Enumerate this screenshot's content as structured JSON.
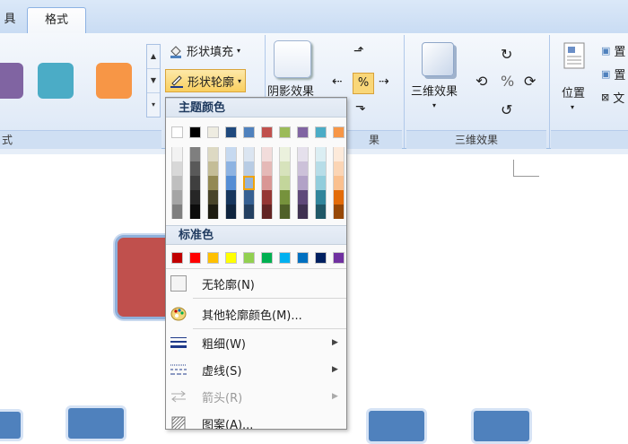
{
  "tabs": {
    "left_fragment": "具",
    "format": "格式"
  },
  "ribbon": {
    "shape_styles": {
      "group_label": "式",
      "swatch_colors": [
        "#8064a2",
        "#4bacc6",
        "#f79646"
      ],
      "fill_label": "形状填充",
      "outline_label": "形状轮廓"
    },
    "shadow_effects": {
      "button_label": "阴影效果",
      "group_label_fragment": "果"
    },
    "three_d": {
      "button_label": "三维效果",
      "group_label": "三维效果"
    },
    "arrange": {
      "position_label": "位置",
      "right_fragments": [
        "置",
        "置",
        "文"
      ]
    }
  },
  "menu": {
    "theme_colors_header": "主题颜色",
    "theme_base_colors": [
      "#ffffff",
      "#000000",
      "#eeece1",
      "#1f497d",
      "#4f81bd",
      "#c0504d",
      "#9bbb59",
      "#8064a2",
      "#4bacc6",
      "#f79646"
    ],
    "theme_shades": [
      [
        "#f2f2f2",
        "#d8d8d8",
        "#bfbfbf",
        "#a5a5a5",
        "#7f7f7f"
      ],
      [
        "#7f7f7f",
        "#595959",
        "#3f3f3f",
        "#262626",
        "#0c0c0c"
      ],
      [
        "#ddd9c3",
        "#c4bd97",
        "#938953",
        "#494429",
        "#1d1b10"
      ],
      [
        "#c6d9f0",
        "#8db3e2",
        "#548dd4",
        "#17365d",
        "#0f243e"
      ],
      [
        "#dbe5f1",
        "#b8cce4",
        "#95b3d7",
        "#366092",
        "#244061"
      ],
      [
        "#f2dcdb",
        "#e5b9b7",
        "#d99694",
        "#953734",
        "#632423"
      ],
      [
        "#ebf1dd",
        "#d7e3bc",
        "#c3d69b",
        "#76923c",
        "#4f6128"
      ],
      [
        "#e5e0ec",
        "#ccc1d9",
        "#b2a2c7",
        "#5f497a",
        "#3f3151"
      ],
      [
        "#dbeef3",
        "#b7dde8",
        "#92cddc",
        "#31859b",
        "#205867"
      ],
      [
        "#fdeada",
        "#fbd5b5",
        "#fac08f",
        "#e36c09",
        "#974806"
      ]
    ],
    "standard_colors_header": "标准色",
    "standard_colors": [
      "#c00000",
      "#ff0000",
      "#ffc000",
      "#ffff00",
      "#92d050",
      "#00b050",
      "#00b0f0",
      "#0070c0",
      "#002060",
      "#7030a0"
    ],
    "no_outline": "无轮廓(N)",
    "more_colors": "其他轮廓颜色(M)...",
    "weight": "粗细(W)",
    "dashes": "虚线(S)",
    "arrows": "箭头(R)",
    "pattern": "图案(A)..."
  },
  "canvas": {
    "selected_shape_color": "#c0504d",
    "shape_color": "#4f81bd"
  }
}
